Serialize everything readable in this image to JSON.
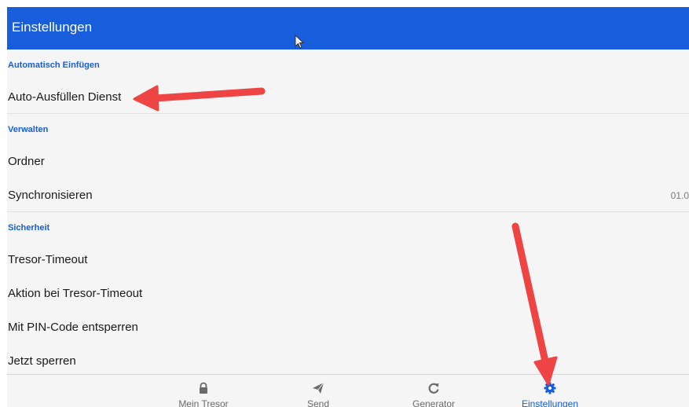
{
  "header": {
    "title": "Einstellungen"
  },
  "sections": {
    "autofill": {
      "title": "Automatisch Einfügen",
      "items": {
        "autofill_service": "Auto-Ausfüllen Dienst"
      }
    },
    "manage": {
      "title": "Verwalten",
      "items": {
        "folders": "Ordner",
        "sync": "Synchronisieren",
        "sync_value": "01.0"
      }
    },
    "security": {
      "title": "Sicherheit",
      "items": {
        "vault_timeout": "Tresor-Timeout",
        "timeout_action": "Aktion bei Tresor-Timeout",
        "pin_unlock": "Mit PIN-Code entsperren",
        "lock_now": "Jetzt sperren"
      }
    }
  },
  "tabs": [
    {
      "label": "Mein Tresor",
      "icon": "lock-icon"
    },
    {
      "label": "Send",
      "icon": "send-icon"
    },
    {
      "label": "Generator",
      "icon": "refresh-icon"
    },
    {
      "label": "Einstellungen",
      "icon": "gear-icon",
      "active": true
    }
  ],
  "colors": {
    "primary": "#175ddc",
    "background": "#f5f5f5",
    "text": "#1a1a1a",
    "muted": "#6b6b6b",
    "annotation_arrow": "#ef4444"
  }
}
